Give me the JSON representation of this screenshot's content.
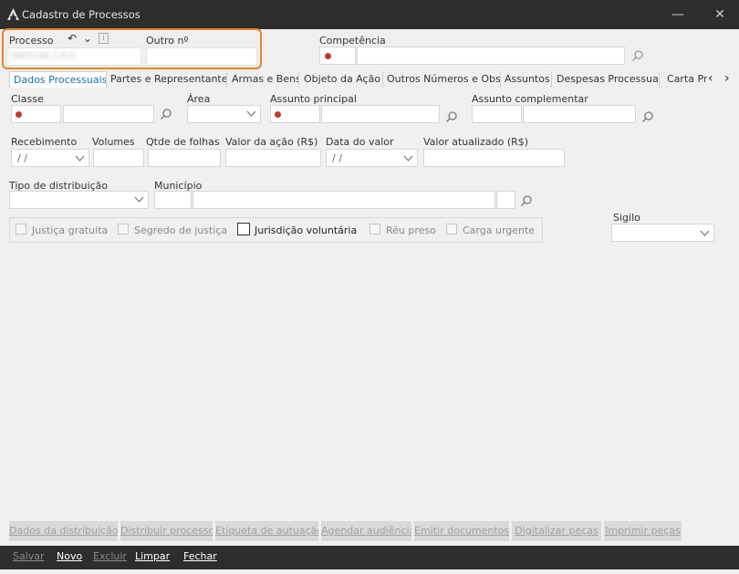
{
  "window": {
    "title": "Cadastro de Processos",
    "minimize_glyph": "—",
    "close_glyph": "✕"
  },
  "header": {
    "processo_label": "Processo",
    "processo_value": "0001/16.1.0.0",
    "undo_glyph": "↶",
    "dropdown_glyph": "⌄",
    "info_glyph": "i",
    "outro_label": "Outro nº",
    "competencia_label": "Competência"
  },
  "tabs": [
    {
      "label": "Dados Processuais"
    },
    {
      "label": "Partes e Representantes"
    },
    {
      "label": "Armas e Bens"
    },
    {
      "label": "Objeto da Ação"
    },
    {
      "label": "Outros Números e Obs."
    },
    {
      "label": "Assuntos"
    },
    {
      "label": "Despesas Processuais"
    },
    {
      "label": "Carta Pr"
    }
  ],
  "tab_scroll": {
    "left": "‹",
    "right": "›"
  },
  "form": {
    "classe_label": "Classe",
    "area_label": "Área",
    "assunto_principal_label": "Assunto principal",
    "assunto_complementar_label": "Assunto complementar",
    "recebimento_label": "Recebimento",
    "recebimento_value": " / /",
    "volumes_label": "Volumes",
    "qtde_folhas_label": "Qtde de folhas",
    "valor_acao_label": "Valor da ação (R$)",
    "data_valor_label": "Data do valor",
    "data_valor_value": " / /",
    "valor_atualizado_label": "Valor atualizado (R$)",
    "tipo_distribuicao_label": "Tipo de distribuição",
    "municipio_label": "Município",
    "sigilo_label": "Sigilo"
  },
  "checkboxes": [
    {
      "label": "Justiça gratuita"
    },
    {
      "label": "Segredo de justiça"
    },
    {
      "label": "Jurisdição voluntária"
    },
    {
      "label": "Réu preso"
    },
    {
      "label": "Carga urgente"
    }
  ],
  "actions": [
    {
      "label": "Dados da distribuição"
    },
    {
      "label": "Distribuir processo"
    },
    {
      "label": "Etiqueta de autuação"
    },
    {
      "label": "Agendar audiência"
    },
    {
      "label": "Emitir documentos"
    },
    {
      "label": "Digitalizar peças"
    },
    {
      "label": "Imprimir peças"
    }
  ],
  "footer": {
    "salvar": "Salvar",
    "novo": "Novo",
    "excluir": "Excluir",
    "limpar": "Limpar",
    "fechar": "Fechar"
  },
  "colors": {
    "titlebar": "#2d2d2d",
    "highlight_border": "#e8832a",
    "active_tab_text": "#1a6ea8",
    "required_dot": "#c0392b"
  }
}
